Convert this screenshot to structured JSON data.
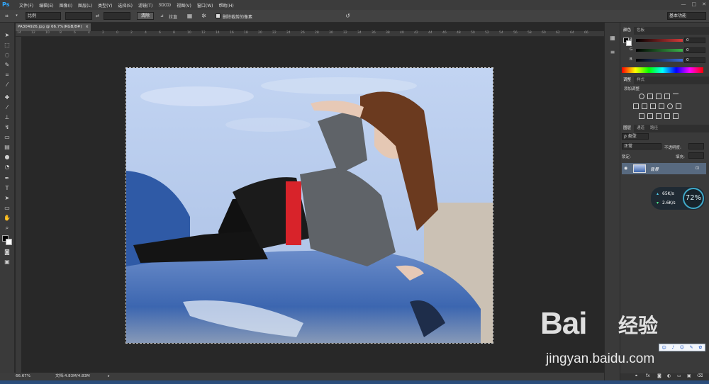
{
  "app": {
    "logo": "Ps",
    "menus": [
      "文件(F)",
      "编辑(E)",
      "图像(I)",
      "图层(L)",
      "类型(Y)",
      "选择(S)",
      "滤镜(T)",
      "3D(D)",
      "视图(V)",
      "窗口(W)",
      "帮助(H)"
    ],
    "window_controls": [
      "—",
      "□",
      "✕"
    ]
  },
  "options_bar": {
    "ratio_value": "比例",
    "straighten_label": "拉直",
    "clear_label": "清除",
    "delete_cropped_label": "删除裁剪的像素",
    "workspace": "基本功能"
  },
  "document": {
    "tab_title": "PA304926.jpg @ 66.7%(RGB/8#)",
    "ruler_ticks": [
      "14",
      "12",
      "10",
      "8",
      "6",
      "4",
      "2",
      "0",
      "2",
      "4",
      "6",
      "8",
      "10",
      "12",
      "14",
      "16",
      "18",
      "20",
      "22",
      "24",
      "26",
      "28",
      "30",
      "32",
      "34",
      "36",
      "38",
      "40",
      "42",
      "44",
      "46",
      "48",
      "50",
      "52",
      "54",
      "56",
      "58",
      "60",
      "62",
      "64",
      "66"
    ]
  },
  "status_bar": {
    "zoom": "66.67%",
    "doc_info": "文档:4.83M/4.83M"
  },
  "color_panel": {
    "tabs": [
      "颜色",
      "色板"
    ],
    "channels": [
      {
        "label": "R",
        "value": "0",
        "color": "#d63a3a"
      },
      {
        "label": "G",
        "value": "0",
        "color": "#3ab54a"
      },
      {
        "label": "B",
        "value": "0",
        "color": "#3a6ad6"
      }
    ]
  },
  "adjustments_panel": {
    "tabs": [
      "调整",
      "样式"
    ],
    "add_label": "添加调整"
  },
  "layers_panel": {
    "tabs": [
      "图层",
      "通道",
      "路径"
    ],
    "kind_label": "ρ 类型",
    "blend_mode": "正常",
    "opacity_label": "不透明度:",
    "lock_label": "锁定:",
    "fill_label": "填充:",
    "layer_name": "背景"
  },
  "net_widget": {
    "up": "65K/s",
    "down": "2.6K/s",
    "percent": "72%"
  },
  "watermark": {
    "logo": "Bai",
    "logo2": "经验",
    "url": "jingyan.baidu.com",
    "ime": [
      "中",
      "♪",
      "☺",
      "✎",
      "✿"
    ]
  },
  "colors": {
    "accent": "#31a8ff",
    "layer_selected": "#586a80"
  }
}
